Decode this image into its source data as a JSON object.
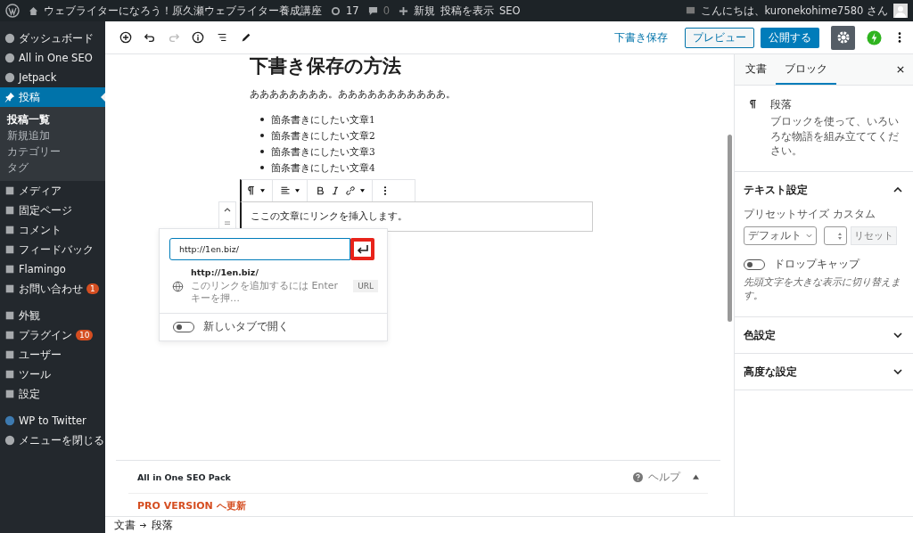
{
  "admin_bar": {
    "site_title": "ウェブライターになろう！原久瀬ウェブライター養成講座",
    "updates": "17",
    "comments": "0",
    "new": "新規",
    "view_post": "投稿を表示",
    "seo": "SEO",
    "greeting": "こんにちは、kuronekohime7580 さん"
  },
  "sidebar": {
    "groups": [
      [
        {
          "label": "ダッシュボード",
          "selected": false
        },
        {
          "label": "All in One SEO",
          "selected": false
        },
        {
          "label": "Jetpack",
          "selected": false
        },
        {
          "label": "投稿",
          "selected": true,
          "children": [
            {
              "label": "投稿一覧",
              "selected": true
            },
            {
              "label": "新規追加",
              "selected": false
            },
            {
              "label": "カテゴリー",
              "selected": false
            },
            {
              "label": "タグ",
              "selected": false
            }
          ]
        },
        {
          "label": "メディア",
          "selected": false
        },
        {
          "label": "固定ページ",
          "selected": false
        },
        {
          "label": "コメント",
          "selected": false
        },
        {
          "label": "フィードバック",
          "selected": false
        },
        {
          "label": "Flamingo",
          "selected": false
        },
        {
          "label": "お問い合わせ",
          "selected": false,
          "badge": "1"
        }
      ],
      [
        {
          "label": "外観",
          "selected": false
        },
        {
          "label": "プラグイン",
          "selected": false,
          "badge": "10"
        },
        {
          "label": "ユーザー",
          "selected": false
        },
        {
          "label": "ツール",
          "selected": false
        },
        {
          "label": "設定",
          "selected": false
        }
      ],
      [
        {
          "label": "WP to Twitter",
          "selected": false
        },
        {
          "label": "メニューを閉じる",
          "selected": false
        }
      ]
    ]
  },
  "header": {
    "save_draft": "下書き保存",
    "preview": "プレビュー",
    "publish": "公開する",
    "settings_selected": true
  },
  "post": {
    "title": "下書き保存の方法",
    "paragraph": "ああああああああ。あああああああああああ。",
    "list": [
      "箇条書きにしたい文章1",
      "箇条書きにしたい文章2",
      "箇条書きにしたい文章3",
      "箇条書きにしたい文章4"
    ],
    "selected_paragraph": "ここの文章にリンクを挿入します。"
  },
  "link_popover": {
    "url": "http://1en.biz/",
    "submit_highlighted": true,
    "suggestion": {
      "title": "http://1en.biz/",
      "hint": "このリンクを追加するには Enter キーを押…",
      "tag": "URL"
    },
    "new_tab": {
      "label": "新しいタブで開く",
      "on": false
    }
  },
  "settings_panel": {
    "tabs": [
      {
        "label": "文書",
        "selected": false
      },
      {
        "label": "ブロック",
        "selected": true
      }
    ],
    "block": {
      "name": "段落",
      "description": "ブロックを使って、いろいろな物語を組み立ててください。"
    },
    "sections": [
      {
        "title": "テキスト設定",
        "expanded": true
      },
      {
        "title": "色設定",
        "expanded": false
      },
      {
        "title": "高度な設定",
        "expanded": false
      }
    ],
    "text_settings": {
      "preset_label": "プリセットサイズ",
      "preset_value": "デフォルト",
      "custom_label": "カスタム",
      "reset": "リセット",
      "drop_cap": {
        "label": "ドロップキャップ",
        "on": false,
        "help": "先頭文字を大きな表示に切り替えます。"
      }
    }
  },
  "meta_box": {
    "title": "All in One SEO Pack",
    "help": "ヘルプ",
    "pro": "PRO VERSION へ更新"
  },
  "breadcrumb": [
    "文書",
    "段落"
  ]
}
